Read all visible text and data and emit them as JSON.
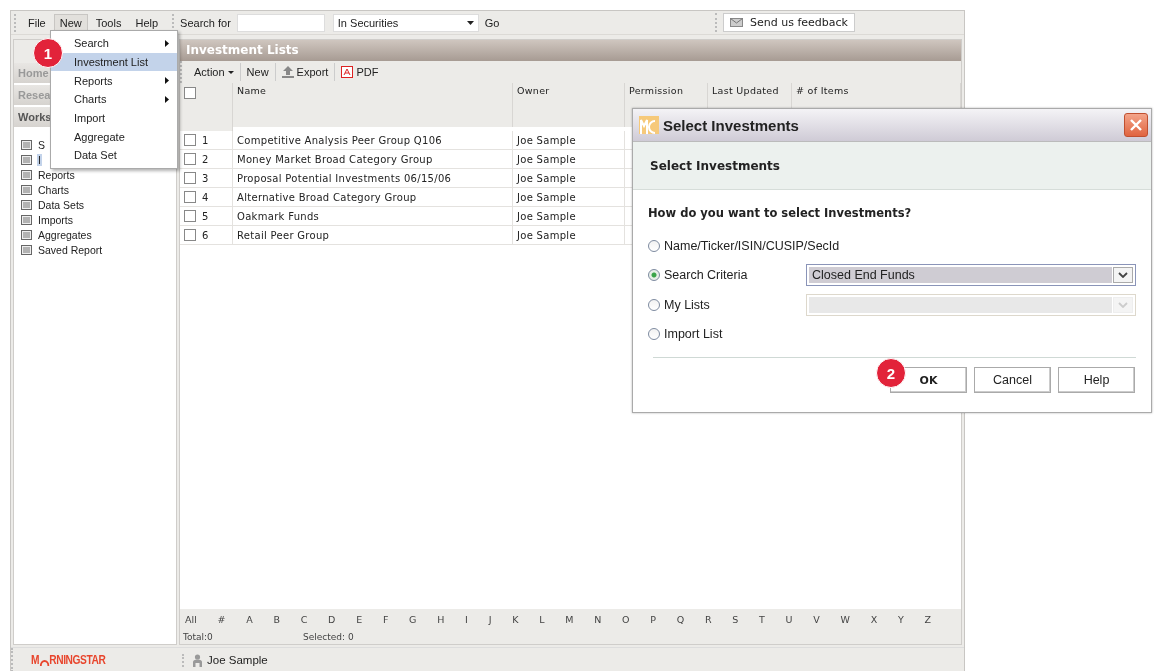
{
  "menu_bar": [
    {
      "label": "File",
      "selected": false
    },
    {
      "label": "New",
      "selected": true
    },
    {
      "label": "Tools",
      "selected": false
    },
    {
      "label": "Help",
      "selected": false
    }
  ],
  "search": {
    "label": "Search for",
    "scope": "In Securities",
    "go": "Go"
  },
  "feedback_button": "Send us feedback",
  "new_menu": [
    {
      "label": "Search",
      "submenu": true,
      "selected": false
    },
    {
      "label": "Investment List",
      "submenu": false,
      "selected": true
    },
    {
      "label": "Reports",
      "submenu": true,
      "selected": false
    },
    {
      "label": "Charts",
      "submenu": true,
      "selected": false
    },
    {
      "label": "Import",
      "submenu": false,
      "selected": false
    },
    {
      "label": "Aggregate",
      "submenu": false,
      "selected": false
    },
    {
      "label": "Data Set",
      "submenu": false,
      "selected": false
    }
  ],
  "sidebar": {
    "tabs": [
      {
        "label": "Home",
        "selected": false
      },
      {
        "label": "Resea",
        "selected": false
      },
      {
        "label": "Works",
        "selected": true
      }
    ],
    "items": [
      {
        "label": "S",
        "selected": false
      },
      {
        "label": "I",
        "selected": true
      },
      {
        "label": "Reports",
        "selected": false
      },
      {
        "label": "Charts",
        "selected": false
      },
      {
        "label": "Data Sets",
        "selected": false
      },
      {
        "label": "Imports",
        "selected": false
      },
      {
        "label": "Aggregates",
        "selected": false
      },
      {
        "label": "Saved Report",
        "selected": false
      }
    ]
  },
  "panel": {
    "title": "Investment Lists",
    "toolbar": [
      {
        "label": "Action",
        "kind": "dropdown"
      },
      {
        "label": "New",
        "kind": "plain"
      },
      {
        "label": "Export",
        "kind": "export"
      },
      {
        "label": "PDF",
        "kind": "pdf"
      }
    ],
    "header_checked": false,
    "columns": [
      "Name",
      "Owner",
      "Permission",
      "Last Updated",
      "# of Items"
    ],
    "rows": [
      {
        "number": "1",
        "name": "Competitive Analysis Peer Group Q106",
        "owner": "Joe Sample",
        "checked": false
      },
      {
        "number": "2",
        "name": "Money Market Broad Category Group",
        "owner": "Joe Sample",
        "checked": false
      },
      {
        "number": "3",
        "name": "Proposal Potential Investments 06/15/06",
        "owner": "Joe Sample",
        "checked": false
      },
      {
        "number": "4",
        "name": "Alternative Broad Category Group",
        "owner": "Joe Sample",
        "checked": false
      },
      {
        "number": "5",
        "name": "Oakmark Funds",
        "owner": "Joe Sample",
        "checked": false
      },
      {
        "number": "6",
        "name": "Retail Peer Group",
        "owner": "Joe Sample",
        "checked": false
      }
    ],
    "alphabet": [
      "All",
      "#",
      "A",
      "B",
      "C",
      "D",
      "E",
      "F",
      "G",
      "H",
      "I",
      "J",
      "K",
      "L",
      "M",
      "N",
      "O",
      "P",
      "Q",
      "R",
      "S",
      "T",
      "U",
      "V",
      "W",
      "X",
      "Y",
      "Z"
    ],
    "total": "Total:0",
    "selected_count": "Selected: 0"
  },
  "status_bar": {
    "logo": [
      "M",
      "RNINGSTAR"
    ],
    "user": "Joe Sample"
  },
  "callouts": [
    "1",
    "2"
  ],
  "dialog": {
    "title": "Select Investments",
    "heading": "Select Investments",
    "question": "How do you want to select Investments?",
    "options": [
      {
        "label": "Name/Ticker/ISIN/CUSIP/SecId",
        "selected": false,
        "kind": "plain"
      },
      {
        "label": "Search Criteria",
        "selected": true,
        "kind": "select",
        "value": "Closed End Funds",
        "disabled": false
      },
      {
        "label": "My Lists",
        "selected": false,
        "kind": "select",
        "disabled": true
      },
      {
        "label": "Import List",
        "selected": false,
        "kind": "plain"
      }
    ],
    "buttons": [
      {
        "label": "OK",
        "default": true
      },
      {
        "label": "Cancel",
        "default": false
      },
      {
        "label": "Help",
        "default": false
      }
    ]
  }
}
